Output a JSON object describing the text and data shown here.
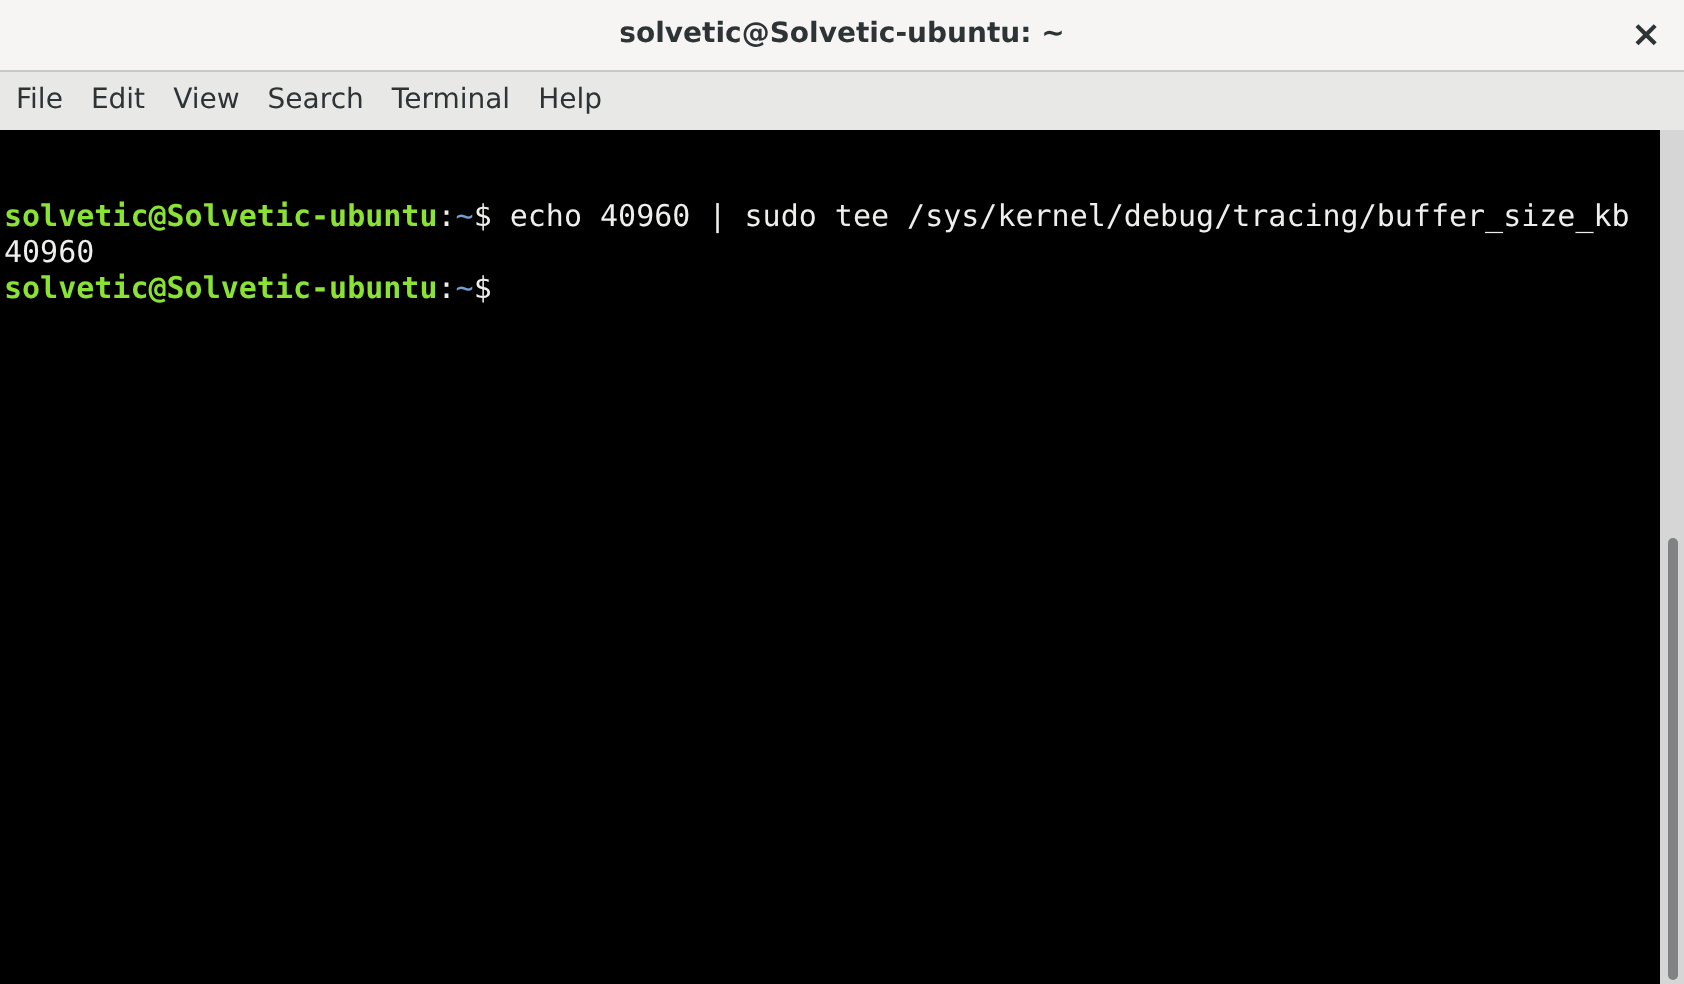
{
  "window": {
    "title": "solvetic@Solvetic-ubuntu: ~",
    "close": "×"
  },
  "menu": [
    "File",
    "Edit",
    "View",
    "Search",
    "Terminal",
    "Help"
  ],
  "terminal": {
    "lines": [
      {
        "segments": [
          {
            "kind": "user",
            "text": "solvetic@Solvetic-ubuntu"
          },
          {
            "kind": "plain",
            "text": ":"
          },
          {
            "kind": "path",
            "text": "~"
          },
          {
            "kind": "plain",
            "text": "$ echo 40960 | sudo tee /sys/kernel/debug/tracing/buffer_size_kb"
          }
        ]
      },
      {
        "segments": [
          {
            "kind": "plain",
            "text": "40960"
          }
        ]
      },
      {
        "segments": [
          {
            "kind": "user",
            "text": "solvetic@Solvetic-ubuntu"
          },
          {
            "kind": "plain",
            "text": ":"
          },
          {
            "kind": "path",
            "text": "~"
          },
          {
            "kind": "plain",
            "text": "$"
          }
        ]
      }
    ]
  }
}
